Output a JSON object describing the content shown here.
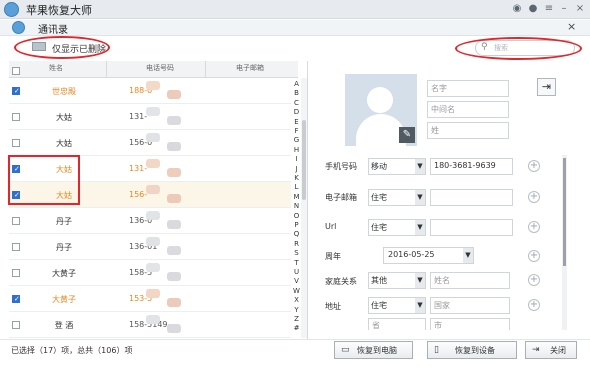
{
  "app": {
    "title": "苹果恢复大师"
  },
  "window": {
    "title": "通讯录",
    "close": "×"
  },
  "toolbar": {
    "show_deleted_label": "仅显示已删除",
    "search_placeholder": "搜索"
  },
  "table": {
    "headers": [
      "姓名",
      "电话号码",
      "电子邮箱"
    ],
    "rows": [
      {
        "name": "世忠殿",
        "phone": "188-0",
        "checked": true,
        "deleted": true,
        "selected": false
      },
      {
        "name": "大姑",
        "phone": "131-",
        "checked": false,
        "deleted": false,
        "selected": false
      },
      {
        "name": "大姑",
        "phone": "156-0",
        "checked": false,
        "deleted": false,
        "selected": false
      },
      {
        "name": "大姑",
        "phone": "131-",
        "checked": true,
        "deleted": true,
        "selected": false
      },
      {
        "name": "大姑",
        "phone": "156-",
        "checked": true,
        "deleted": true,
        "selected": true
      },
      {
        "name": "丹子",
        "phone": "136-0",
        "checked": false,
        "deleted": false,
        "selected": false
      },
      {
        "name": "丹子",
        "phone": "136-01",
        "checked": false,
        "deleted": false,
        "selected": false
      },
      {
        "name": "大黄子",
        "phone": "158-5",
        "checked": false,
        "deleted": false,
        "selected": false
      },
      {
        "name": "大黄子",
        "phone": "153-5",
        "checked": true,
        "deleted": true,
        "selected": false
      },
      {
        "name": "登 酒",
        "phone": "158-5149-",
        "checked": false,
        "deleted": false,
        "selected": false
      }
    ],
    "alphabet": [
      "A",
      "B",
      "C",
      "D",
      "E",
      "F",
      "G",
      "H",
      "I",
      "J",
      "K",
      "L",
      "M",
      "N",
      "O",
      "P",
      "Q",
      "R",
      "S",
      "T",
      "U",
      "V",
      "W",
      "X",
      "Y",
      "Z",
      "#"
    ]
  },
  "detail": {
    "name_placeholder": "名字",
    "middle_placeholder": "中间名",
    "last_placeholder": "姓",
    "phone": {
      "label": "手机号码",
      "type": "移动",
      "value": "180-3681-9639"
    },
    "email": {
      "label": "电子邮箱",
      "type": "住宅",
      "value": ""
    },
    "url": {
      "label": "Url",
      "type": "住宅",
      "value": ""
    },
    "birthday": {
      "label": "周年",
      "value": "2016-05-25"
    },
    "relation": {
      "label": "家庭关系",
      "type": "其他",
      "placeholder": "姓名"
    },
    "address": {
      "label": "地址",
      "type": "住宅",
      "country_placeholder": "国家",
      "province_placeholder": "省",
      "city_placeholder": "市"
    }
  },
  "status": {
    "text": "已选择（17）项，总共（106）项"
  },
  "buttons": {
    "restore_pc": "恢复到电脑",
    "restore_device": "恢复到设备",
    "close": "关闭"
  },
  "colors": {
    "deleted_text": "#e58a22",
    "highlight": "#e2262b",
    "checkbox": "#2f6fce"
  }
}
